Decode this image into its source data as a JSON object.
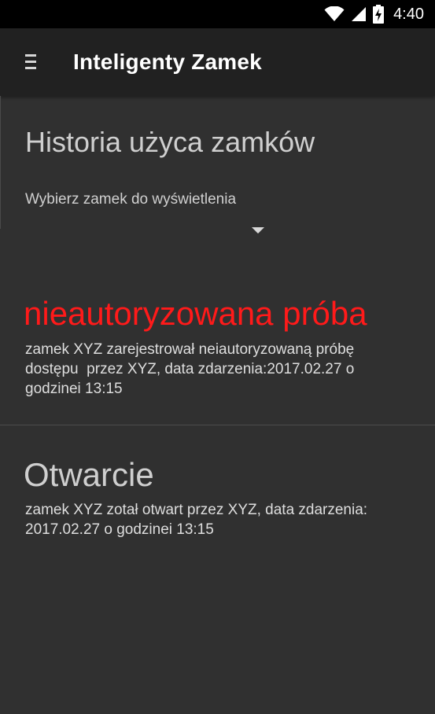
{
  "status_bar": {
    "time": "4:40",
    "icons": [
      "wifi-icon",
      "signal-icon",
      "battery-charging-icon"
    ]
  },
  "app_bar": {
    "title": "Inteligenty Zamek",
    "menu_icon": "hamburger-menu-icon"
  },
  "page": {
    "title": "Historia użyca zamków",
    "spinner_label": "Wybierz zamek do wyświetlenia",
    "spinner_icon": "dropdown-arrow-icon"
  },
  "events": [
    {
      "title": "nieautoryzowana próba",
      "title_color": "#ff1a1a",
      "description": "zamek XYZ zarejestrował neiautoryzowaną próbę\ndostępu  przez XYZ, data zdarzenia:2017.02.27 o\ngodzinei 13:15"
    },
    {
      "title": "Otwarcie",
      "title_color": "#cfcfcf",
      "description": "zamek XYZ zotał otwart przez XYZ, data zdarzenia:\n2017.02.27 o godzinei 13:15"
    }
  ],
  "colors": {
    "background": "#303030",
    "app_bar": "#212121",
    "status_bar": "#000000",
    "alert": "#ff1a1a"
  }
}
